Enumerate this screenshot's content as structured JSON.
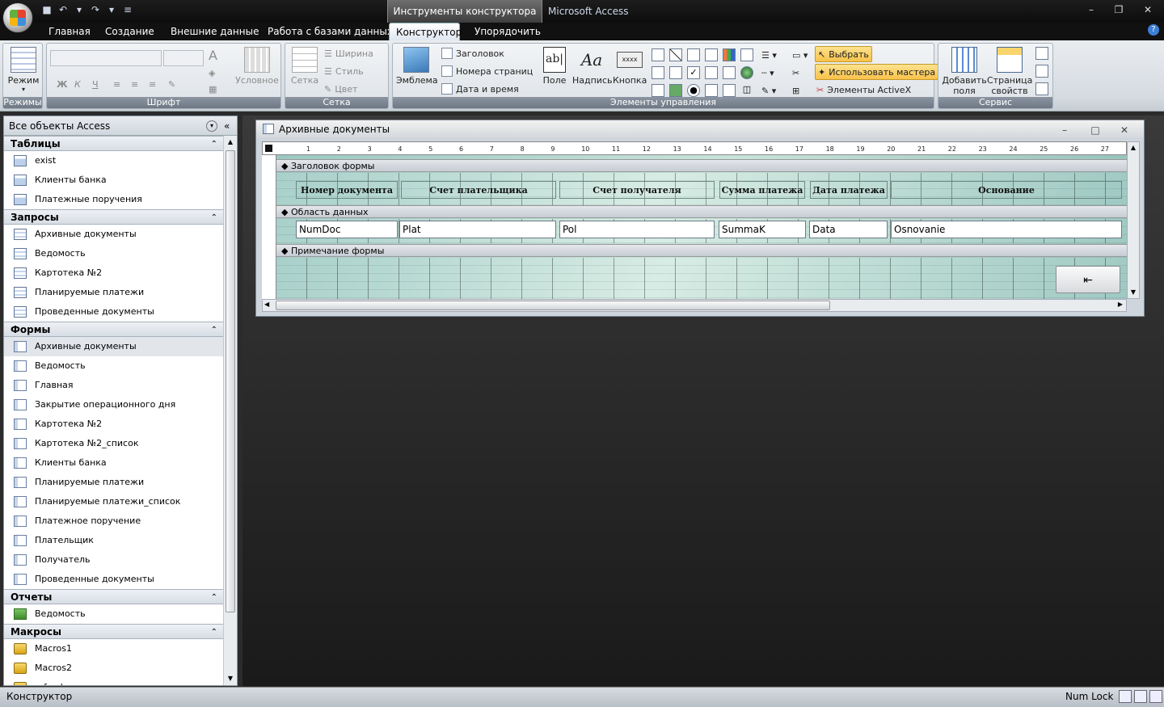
{
  "titlebar": {
    "context_tab": "Инструменты конструктора форм",
    "app_title": "Microsoft Access"
  },
  "ribbon_tabs": [
    "Главная",
    "Создание",
    "Внешние данные",
    "Работа с базами данных",
    "Конструктор",
    "Упорядочить"
  ],
  "ribbon": {
    "views": {
      "button": "Режим",
      "group": "Режимы"
    },
    "font": {
      "group": "Шрифт",
      "conditional": "Условное",
      "bold": "Ж",
      "italic": "К",
      "underline": "Ч"
    },
    "grid": {
      "button": "Сетка",
      "width": "Ширина",
      "style": "Стиль",
      "color": "Цвет",
      "group": "Сетка"
    },
    "controls": {
      "group": "Элементы управления",
      "logo": "Эмблема",
      "title": "Заголовок",
      "page_numbers": "Номера страниц",
      "date_time": "Дата и время",
      "field": "Поле",
      "label": "Надпись",
      "button": "Кнопка",
      "select": "Выбрать",
      "use_wizards": "Использовать мастера",
      "activex": "Элементы ActiveX"
    },
    "tools": {
      "group": "Сервис",
      "add_fields_l1": "Добавить",
      "add_fields_l2": "поля",
      "property_sheet_l1": "Страница",
      "property_sheet_l2": "свойств"
    }
  },
  "nav": {
    "header": "Все объекты Access",
    "sections": [
      {
        "title": "Таблицы",
        "type": "table",
        "items": [
          "exist",
          "Клиенты банка",
          "Платежные поручения"
        ]
      },
      {
        "title": "Запросы",
        "type": "query",
        "items": [
          "Архивные документы",
          "Ведомость",
          "Картотека №2",
          "Планируемые платежи",
          "Проведенные документы"
        ]
      },
      {
        "title": "Формы",
        "type": "form",
        "items": [
          "Архивные документы",
          "Ведомость",
          "Главная",
          "Закрытие операционного дня",
          "Картотека №2",
          "Картотека №2_список",
          "Клиенты банка",
          "Планируемые платежи",
          "Планируемые платежи_список",
          "Платежное поручение",
          "Плательщик",
          "Получатель",
          "Проведенные документы"
        ]
      },
      {
        "title": "Отчеты",
        "type": "report",
        "items": [
          "Ведомость"
        ]
      },
      {
        "title": "Макросы",
        "type": "macro",
        "items": [
          "Macros1",
          "Macros2",
          "refresh"
        ]
      }
    ]
  },
  "form": {
    "title": "Архивные документы",
    "bands": {
      "header": "Заголовок формы",
      "detail": "Область данных",
      "footer": "Примечание формы"
    },
    "labels": [
      "Номер документа",
      "Счет плательщика",
      "Счет получателя",
      "Сумма платежа",
      "Дата платежа",
      "Основание"
    ],
    "fields": [
      "NumDoc",
      "Plat",
      "Pol",
      "SummaK",
      "Data",
      "Osnovanie"
    ],
    "ruler": [
      "1",
      "2",
      "3",
      "4",
      "5",
      "6",
      "7",
      "8",
      "9",
      "10",
      "11",
      "12",
      "13",
      "14",
      "15",
      "16",
      "17",
      "18",
      "19",
      "20",
      "21",
      "22",
      "23",
      "24",
      "25",
      "26",
      "27"
    ]
  },
  "status": {
    "mode": "Конструктор",
    "numlock": "Num Lock"
  },
  "colors": {
    "accent": "#f9c14a",
    "ribbon_bg": "#dde2e7",
    "workspace": "#2b2b2b"
  }
}
